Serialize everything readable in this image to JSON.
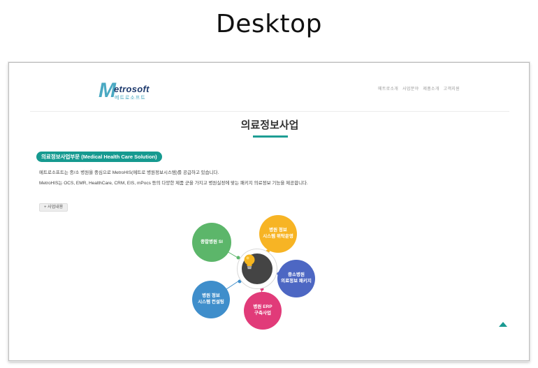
{
  "caption": "Desktop",
  "header": {
    "logo_letter": "M",
    "logo_name": "etrosoft",
    "logo_sub": "메트로소프트",
    "nav": [
      "메트로소개",
      "사업분야",
      "제품소개",
      "고객지원"
    ]
  },
  "main": {
    "title": "의료정보사업",
    "section_badge": "의료정보사업부문 (Medical Health Care Solution)",
    "description_line1": "메트로소프트는 종/소 병원을 중심으로 MetroHIS(메트로 병원정보시스템)를 공급하고 있습니다.",
    "description_line2": "MetroHIS는 OCS, EMR, HealthCare, CRM, EIS, mPocs 등의 다양한 제품 군을 가지고 병원실정에 맞는 패키지 의료정보 기능을 제공합니다.",
    "detail_button": "+ 사업내용"
  },
  "diagram": {
    "center_icon": "lightbulb-icon",
    "items": [
      {
        "label": "종합병원 SI",
        "color": "#5cb66a"
      },
      {
        "label": "병원 정보\n시스템 위탁운영",
        "color": "#f7b424"
      },
      {
        "label": "중소병원\n의료정보 패키지",
        "color": "#4d67c3"
      },
      {
        "label": "병원 ERP\n구축사업",
        "color": "#e13b79"
      },
      {
        "label": "병원 정보\n시스템 컨설팅",
        "color": "#3f8ecb"
      }
    ]
  },
  "colors": {
    "accent": "#169a90",
    "title_bar": "#1e9e94",
    "scroll_top": "#1a9a92"
  },
  "scroll_top_icon": "triangle-up-icon"
}
